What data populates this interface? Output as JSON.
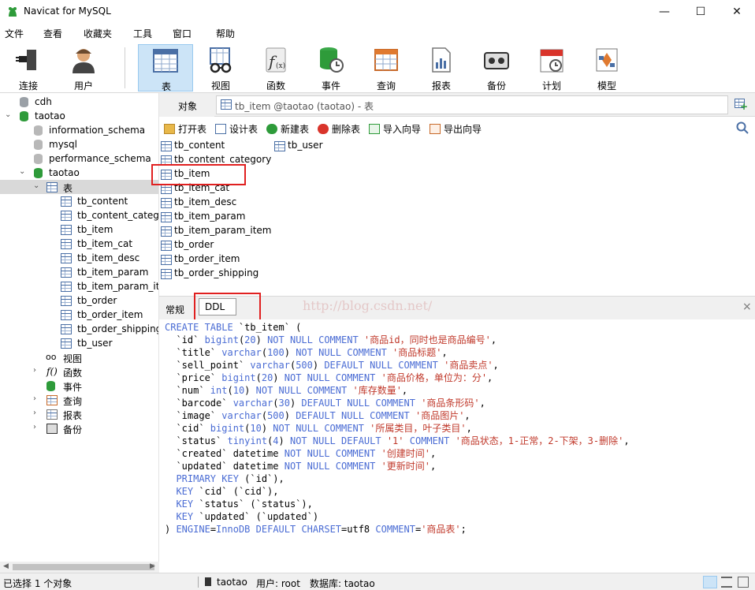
{
  "window": {
    "title": "Navicat for MySQL",
    "minimize": "—",
    "maximize": "☐",
    "close": "✕"
  },
  "menu": [
    "文件",
    "查看",
    "收藏夹",
    "工具",
    "窗口",
    "帮助"
  ],
  "toolbar": [
    "连接",
    "用户",
    "表",
    "视图",
    "函数",
    "事件",
    "查询",
    "报表",
    "备份",
    "计划",
    "模型"
  ],
  "tree": {
    "dbs": [
      "cdh",
      "taotao",
      "information_schema",
      "mysql",
      "performance_schema",
      "taotao"
    ],
    "table_group": "表",
    "tables": [
      "tb_content",
      "tb_content_categc",
      "tb_item",
      "tb_item_cat",
      "tb_item_desc",
      "tb_item_param",
      "tb_item_param_ite",
      "tb_order",
      "tb_order_item",
      "tb_order_shipping",
      "tb_user"
    ],
    "groups": [
      "视图",
      "函数",
      "事件",
      "查询",
      "报表",
      "备份"
    ]
  },
  "tabs": {
    "object": "对象",
    "current": "tb_item @taotao (taotao) - 表"
  },
  "obj_actions": [
    "打开表",
    "设计表",
    "新建表",
    "删除表",
    "导入向导",
    "导出向导"
  ],
  "objects": [
    "tb_content",
    "tb_content_category",
    "tb_item",
    "tb_item_cat",
    "tb_item_desc",
    "tb_item_param",
    "tb_item_param_item",
    "tb_order",
    "tb_order_item",
    "tb_order_shipping",
    "tb_user"
  ],
  "detail": {
    "tab_general": "常规",
    "tab_ddl": "DDL",
    "watermark": "http://blog.csdn.net/",
    "close": "×"
  },
  "ddl_lines": [
    "CREATE TABLE `tb_item` (",
    "  `id` bigint(20) NOT NULL COMMENT '商品id，同时也是商品编号',",
    "  `title` varchar(100) NOT NULL COMMENT '商品标题',",
    "  `sell_point` varchar(500) DEFAULT NULL COMMENT '商品卖点',",
    "  `price` bigint(20) NOT NULL COMMENT '商品价格，单位为：分',",
    "  `num` int(10) NOT NULL COMMENT '库存数量',",
    "  `barcode` varchar(30) DEFAULT NULL COMMENT '商品条形码',",
    "  `image` varchar(500) DEFAULT NULL COMMENT '商品图片',",
    "  `cid` bigint(10) NOT NULL COMMENT '所属类目，叶子类目',",
    "  `status` tinyint(4) NOT NULL DEFAULT '1' COMMENT '商品状态，1-正常，2-下架，3-删除',",
    "  `created` datetime NOT NULL COMMENT '创建时间',",
    "  `updated` datetime NOT NULL COMMENT '更新时间',",
    "  PRIMARY KEY (`id`),",
    "  KEY `cid` (`cid`),",
    "  KEY `status` (`status`),",
    "  KEY `updated` (`updated`)",
    ") ENGINE=InnoDB DEFAULT CHARSET=utf8 COMMENT='商品表';"
  ],
  "status": {
    "selected": "已选择 1 个对象",
    "conn": "taotao",
    "user": "用户: root",
    "db": "数据库: taotao"
  }
}
